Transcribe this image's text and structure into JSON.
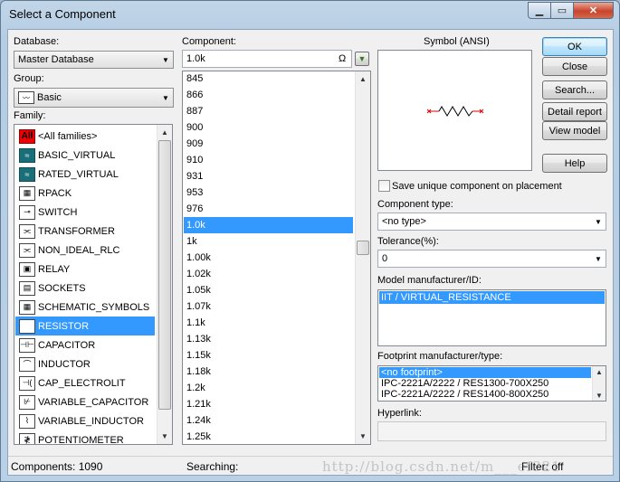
{
  "window": {
    "title": "Select a Component"
  },
  "labels": {
    "database": "Database:",
    "group": "Group:",
    "family": "Family:",
    "component": "Component:",
    "symbol": "Symbol (ANSI)",
    "save_unique": "Save unique component on placement",
    "component_type": "Component type:",
    "tolerance": "Tolerance(%):",
    "model_mfr": "Model manufacturer/ID:",
    "footprint_mfr": "Footprint manufacturer/type:",
    "hyperlink": "Hyperlink:"
  },
  "database": {
    "value": "Master Database"
  },
  "group": {
    "value": "Basic"
  },
  "component_search": {
    "value": "1.0k",
    "omega": "Ω"
  },
  "families": [
    {
      "label": "<All families>",
      "icon": "all-families-icon",
      "badge": "All"
    },
    {
      "label": "BASIC_VIRTUAL",
      "icon": "basic-virtual-icon"
    },
    {
      "label": "RATED_VIRTUAL",
      "icon": "rated-virtual-icon"
    },
    {
      "label": "RPACK",
      "icon": "rpack-icon"
    },
    {
      "label": "SWITCH",
      "icon": "switch-icon"
    },
    {
      "label": "TRANSFORMER",
      "icon": "transformer-icon"
    },
    {
      "label": "NON_IDEAL_RLC",
      "icon": "non-ideal-rlc-icon"
    },
    {
      "label": "RELAY",
      "icon": "relay-icon"
    },
    {
      "label": "SOCKETS",
      "icon": "sockets-icon"
    },
    {
      "label": "SCHEMATIC_SYMBOLS",
      "icon": "schematic-symbols-icon"
    },
    {
      "label": "RESISTOR",
      "icon": "resistor-icon"
    },
    {
      "label": "CAPACITOR",
      "icon": "capacitor-icon"
    },
    {
      "label": "INDUCTOR",
      "icon": "inductor-icon"
    },
    {
      "label": "CAP_ELECTROLIT",
      "icon": "cap-electrolit-icon"
    },
    {
      "label": "VARIABLE_CAPACITOR",
      "icon": "variable-capacitor-icon"
    },
    {
      "label": "VARIABLE_INDUCTOR",
      "icon": "variable-inductor-icon"
    },
    {
      "label": "POTENTIOMETER",
      "icon": "potentiometer-icon"
    }
  ],
  "selected_family": "RESISTOR",
  "components": [
    "845",
    "866",
    "887",
    "900",
    "909",
    "910",
    "931",
    "953",
    "976",
    "1.0k",
    "1k",
    "1.00k",
    "1.02k",
    "1.05k",
    "1.07k",
    "1.1k",
    "1.13k",
    "1.15k",
    "1.18k",
    "1.2k",
    "1.21k",
    "1.24k",
    "1.25k"
  ],
  "selected_component": "1.0k",
  "buttons": {
    "ok": "OK",
    "close": "Close",
    "search": "Search...",
    "detail_report": "Detail report",
    "view_model": "View model",
    "help": "Help"
  },
  "component_type": {
    "value": "<no type>"
  },
  "tolerance": {
    "value": "0"
  },
  "model_list": [
    "IIT / VIRTUAL_RESISTANCE"
  ],
  "footprint_list": [
    "<no footprint>",
    "IPC-2221A/2222 / RES1300-700X250",
    "IPC-2221A/2222 / RES1400-800X250"
  ],
  "status": {
    "components": "Components: 1090",
    "searching": "Searching:",
    "filter": "Filter: off"
  },
  "watermark": "http://blog.csdn.net/m___ef321",
  "colors": {
    "selection": "#3399ff",
    "titlebar": "#b9d0e6",
    "close_button": "#c9432b"
  }
}
